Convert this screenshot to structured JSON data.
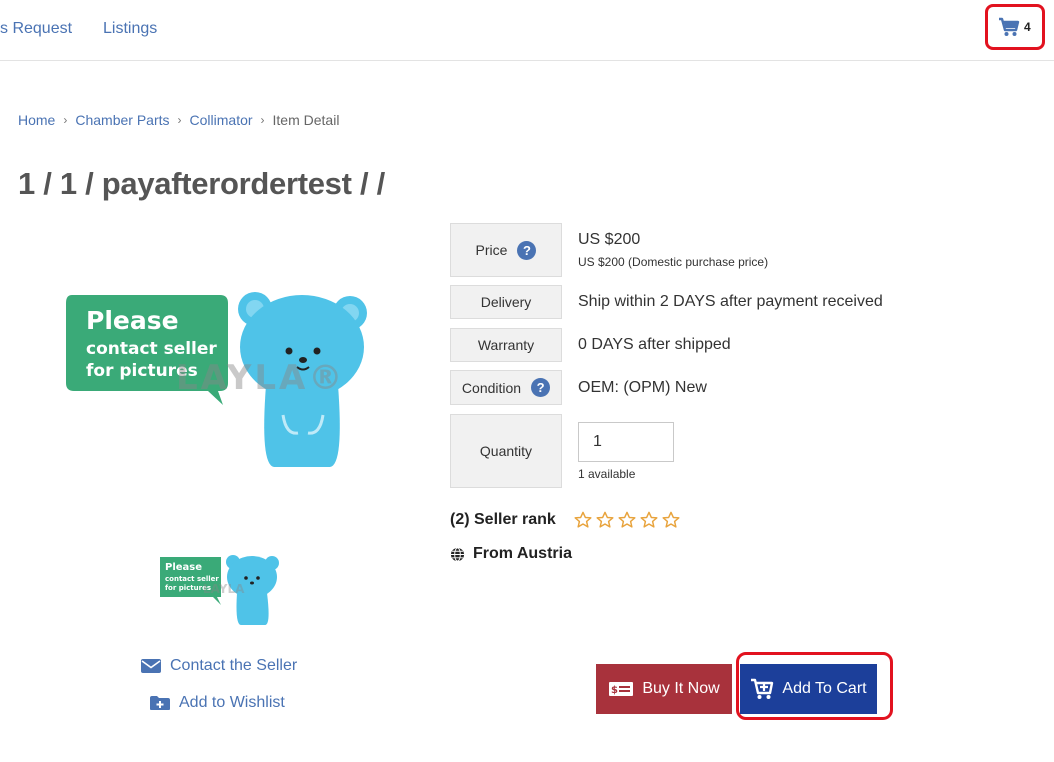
{
  "nav": {
    "request_label": "s Request",
    "listings_label": "Listings",
    "cart_count": "4"
  },
  "breadcrumb": {
    "items": [
      "Home",
      "Chamber Parts",
      "Collimator",
      "Item Detail"
    ]
  },
  "product": {
    "title": "1 / 1 / payafterordertest / /",
    "image_text": {
      "line1": "Please",
      "line2": "contact seller",
      "line3": "for pictures",
      "watermark": "LAYLA®"
    },
    "thumb_text": {
      "line1": "Please",
      "line2": "contact seller",
      "line3": "for pictures",
      "watermark": "LAYLA"
    }
  },
  "links": {
    "contact": "Contact the Seller",
    "wishlist": "Add to Wishlist"
  },
  "specs": {
    "price_label": "Price",
    "price_value": "US $200",
    "price_sub": "US $200 (Domestic purchase price)",
    "delivery_label": "Delivery",
    "delivery_value": "Ship within 2 DAYS after payment received",
    "warranty_label": "Warranty",
    "warranty_value": "0 DAYS after shipped",
    "condition_label": "Condition",
    "condition_value": "OEM: (OPM) New",
    "quantity_label": "Quantity",
    "quantity_value": "1",
    "quantity_available": "1 available",
    "help_glyph": "?"
  },
  "seller": {
    "rank_label": "(2) Seller rank",
    "stars_filled": 0,
    "stars_total": 5,
    "from_label": "From Austria"
  },
  "buttons": {
    "buy_now": "Buy It Now",
    "add_to_cart": "Add To Cart"
  },
  "colors": {
    "link": "#4a73b3",
    "buy_button": "#a8323c",
    "cart_button": "#1c3f9a",
    "highlight": "#e2121f",
    "star": "#e8a33c",
    "mascot": "#4fc3e8",
    "bubble": "#3aaa78"
  },
  "icons": {
    "cart": "shopping-cart-icon",
    "help": "question-circle-icon",
    "envelope": "envelope-icon",
    "folder_plus": "folder-plus-icon",
    "star": "star-outline-icon",
    "globe": "globe-icon",
    "money": "money-bill-icon",
    "cart_plus": "cart-plus-icon"
  }
}
